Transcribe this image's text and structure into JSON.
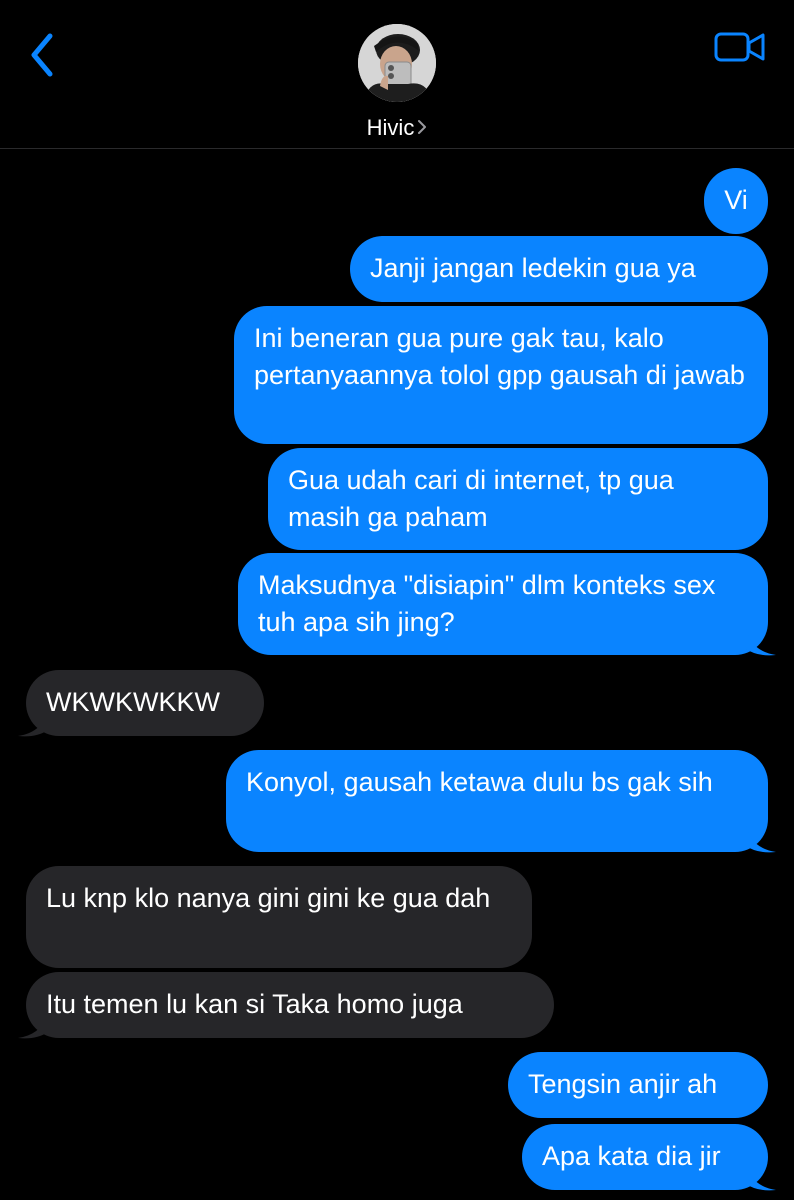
{
  "header": {
    "contact_name": "Hivic",
    "back_icon": "chevron-left-icon",
    "video_icon": "video-camera-icon",
    "accent_color": "#0a84ff"
  },
  "messages": [
    {
      "direction": "sent",
      "text": "Vi"
    },
    {
      "direction": "sent",
      "text": "Janji jangan ledekin gua ya"
    },
    {
      "direction": "sent",
      "text": "Ini beneran gua pure gak tau, kalo pertanyaannya tolol gpp gausah di jawab"
    },
    {
      "direction": "sent",
      "text": "Gua udah cari di internet, tp gua masih ga paham"
    },
    {
      "direction": "sent",
      "text": "Maksudnya \"disiapin\" dlm konteks sex tuh apa sih jing?"
    },
    {
      "direction": "received",
      "text": "WKWKWKKW"
    },
    {
      "direction": "sent",
      "text": "Konyol, gausah ketawa dulu bs gak sih"
    },
    {
      "direction": "received",
      "text": "Lu knp klo nanya gini gini ke gua dah"
    },
    {
      "direction": "received",
      "text": "Itu temen lu kan si Taka homo juga"
    },
    {
      "direction": "sent",
      "text": "Tengsin anjir ah"
    },
    {
      "direction": "sent",
      "text": "Apa kata dia jir"
    }
  ],
  "colors": {
    "background": "#000000",
    "sent_bubble": "#0a84ff",
    "received_bubble": "#262629"
  }
}
